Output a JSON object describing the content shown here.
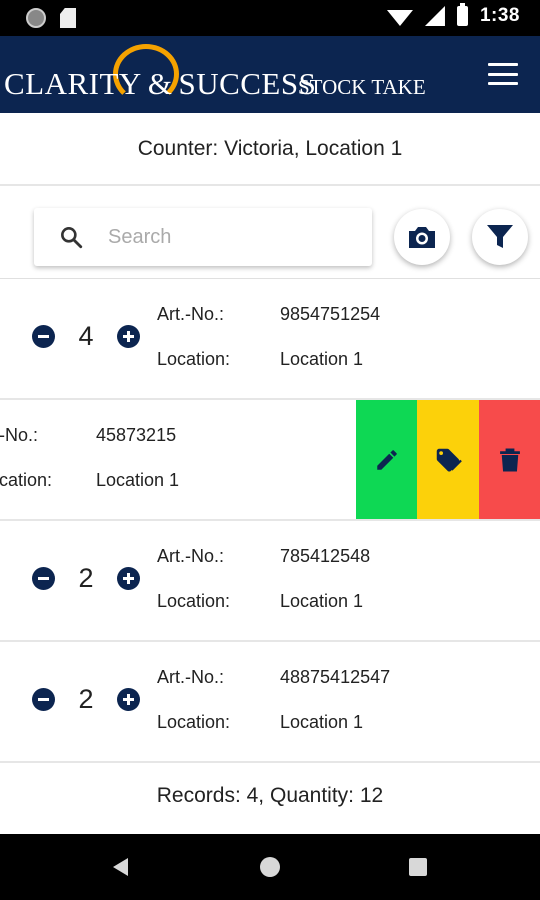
{
  "status_bar": {
    "time": "1:38"
  },
  "header": {
    "brand_left": "CLARITY",
    "brand_amp": "&",
    "brand_right": "SUCCESS",
    "brand_sub": "STOCK TAKE",
    "menu_icon": "hamburger-menu-icon"
  },
  "counter": {
    "text": "Counter: Victoria, Location 1"
  },
  "search": {
    "placeholder": "Search",
    "value": ""
  },
  "labels": {
    "art_no": "Art.-No.:",
    "location": "Location:"
  },
  "items": [
    {
      "quantity": "4",
      "art_no": "9854751254",
      "location": "Location 1"
    },
    {
      "quantity": "",
      "art_no": "45873215",
      "location": "Location 1",
      "art_label_partial": "-No.:",
      "location_label_partial": "cation:"
    },
    {
      "quantity": "2",
      "art_no": "785412548",
      "location": "Location 1"
    },
    {
      "quantity": "2",
      "art_no": "48875412547",
      "location": "Location 1"
    }
  ],
  "swipe_actions": [
    {
      "name": "edit",
      "icon": "pencil-icon",
      "color": "#0ed854"
    },
    {
      "name": "tag",
      "icon": "tag-icon",
      "color": "#fcd10a"
    },
    {
      "name": "delete",
      "icon": "trash-icon",
      "color": "#f74b4b"
    }
  ],
  "footer": {
    "summary": "Records: 4, Quantity: 12"
  },
  "colors": {
    "primary": "#0c2550",
    "accent": "#f5a200"
  }
}
